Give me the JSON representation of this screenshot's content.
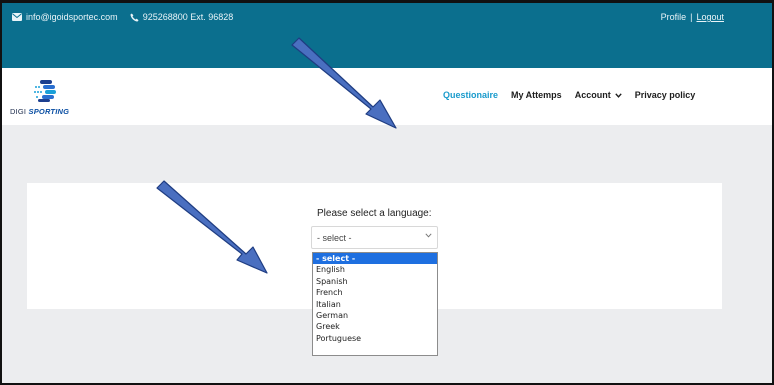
{
  "topbar": {
    "email": "info@igoidsportec.com",
    "phone": "925268800 Ext. 96828",
    "profile_label": "Profile",
    "separator": "|",
    "logout_label": "Logout"
  },
  "logo": {
    "prefix": "DIGI",
    "brand": "SPORTING"
  },
  "menu": {
    "items": [
      {
        "label": "Questionaire"
      },
      {
        "label": "My Attemps"
      },
      {
        "label": "Account"
      },
      {
        "label": "Privacy policy"
      }
    ]
  },
  "language_form": {
    "label": "Please select a language:",
    "selected_value": "- select -",
    "options": [
      "- select -",
      "English",
      "Spanish",
      "French",
      "Italian",
      "German",
      "Greek",
      "Portuguese"
    ]
  },
  "colors": {
    "topbar_bg": "#0b6f8e",
    "active_menu": "#1a9bcc",
    "selected_option": "#1e6fe0",
    "annotation_arrow": "#4a6fc0"
  },
  "icons": {
    "email": "envelope-icon",
    "phone": "phone-icon",
    "account": "chevron-down-icon",
    "select": "chevron-down-icon"
  }
}
